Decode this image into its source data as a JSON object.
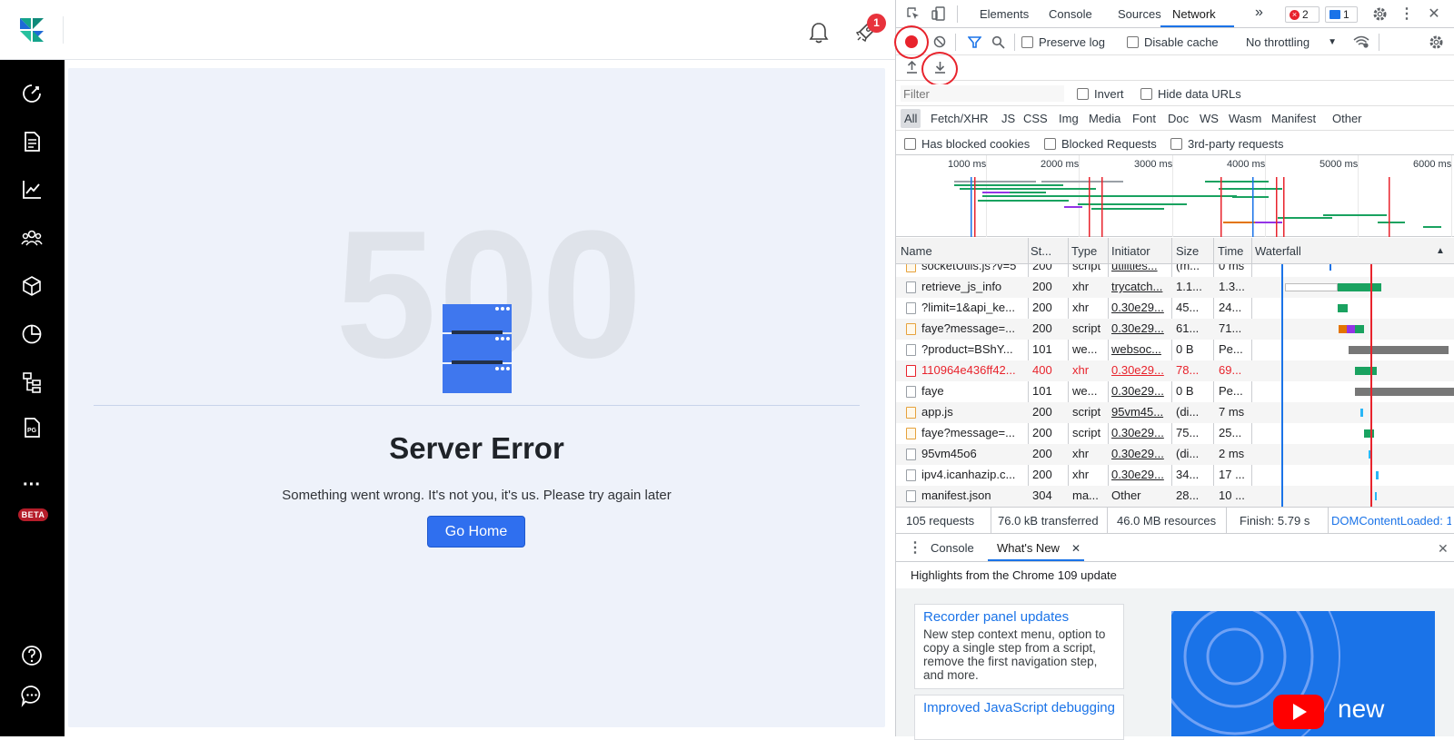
{
  "app": {
    "notification_count": "1",
    "sidebar": [
      {
        "name": "dashboard-icon"
      },
      {
        "name": "document-icon"
      },
      {
        "name": "chart-icon"
      },
      {
        "name": "users-icon"
      },
      {
        "name": "cube-icon"
      },
      {
        "name": "pie-chart-icon"
      },
      {
        "name": "hierarchy-icon"
      },
      {
        "name": "pdf-icon"
      },
      {
        "name": "more-icon"
      },
      {
        "name": "help-icon"
      },
      {
        "name": "chat-icon"
      }
    ],
    "beta_badge": "BETA",
    "more_label": "···",
    "error": {
      "code": "500",
      "title": "Server Error",
      "message": "Something went wrong. It's not you, it's us. Please try again later",
      "button": "Go Home"
    },
    "accent_color": "#2f6fef"
  },
  "devtools": {
    "tabs": [
      "Elements",
      "Console",
      "Sources",
      "Network"
    ],
    "active_tab": "Network",
    "more_tabs": "»",
    "error_count": "2",
    "message_count": "1",
    "toolbar": {
      "preserve_log": "Preserve log",
      "disable_cache": "Disable cache",
      "throttling": "No throttling"
    },
    "filter": {
      "placeholder": "Filter",
      "invert": "Invert",
      "hide_data_urls": "Hide data URLs"
    },
    "types": [
      "All",
      "Fetch/XHR",
      "JS",
      "CSS",
      "Img",
      "Media",
      "Font",
      "Doc",
      "WS",
      "Wasm",
      "Manifest",
      "Other"
    ],
    "blocked": {
      "has_blocked_cookies": "Has blocked cookies",
      "blocked_requests": "Blocked Requests",
      "third_party": "3rd-party requests"
    },
    "overview_ticks": [
      "1000 ms",
      "2000 ms",
      "3000 ms",
      "4000 ms",
      "5000 ms",
      "6000 ms"
    ],
    "columns": [
      "Name",
      "St...",
      "Type",
      "Initiator",
      "Size",
      "Time",
      "Waterfall"
    ],
    "rows": [
      {
        "name": "socketUtils.js?v=5",
        "status": "200",
        "type": "script",
        "initiator": "utilities...",
        "size": "(m...",
        "time": "0 ms",
        "icon": "script",
        "error": false
      },
      {
        "name": "retrieve_js_info",
        "status": "200",
        "type": "xhr",
        "initiator": "trycatch...",
        "size": "1.1...",
        "time": "1.3...",
        "icon": "doc",
        "error": false
      },
      {
        "name": "?limit=1&api_ke...",
        "status": "200",
        "type": "xhr",
        "initiator": "0.30e29...",
        "size": "45...",
        "time": "24...",
        "icon": "doc",
        "error": false
      },
      {
        "name": "faye?message=...",
        "status": "200",
        "type": "script",
        "initiator": "0.30e29...",
        "size": "61...",
        "time": "71...",
        "icon": "script",
        "error": false
      },
      {
        "name": "?product=BShY...",
        "status": "101",
        "type": "we...",
        "initiator": "websoc...",
        "size": "0 B",
        "time": "Pe...",
        "icon": "doc",
        "error": false
      },
      {
        "name": "110964e436ff42...",
        "status": "400",
        "type": "xhr",
        "initiator": "0.30e29...",
        "size": "78...",
        "time": "69...",
        "icon": "doc",
        "error": true
      },
      {
        "name": "faye",
        "status": "101",
        "type": "we...",
        "initiator": "0.30e29...",
        "size": "0 B",
        "time": "Pe...",
        "icon": "doc",
        "error": false
      },
      {
        "name": "app.js",
        "status": "200",
        "type": "script",
        "initiator": "95vm45...",
        "size": "(di...",
        "time": "7 ms",
        "icon": "script",
        "error": false
      },
      {
        "name": "faye?message=...",
        "status": "200",
        "type": "script",
        "initiator": "0.30e29...",
        "size": "75...",
        "time": "25...",
        "icon": "script",
        "error": false
      },
      {
        "name": "95vm45o6",
        "status": "200",
        "type": "xhr",
        "initiator": "0.30e29...",
        "size": "(di...",
        "time": "2 ms",
        "icon": "doc",
        "error": false
      },
      {
        "name": "ipv4.icanhazip.c...",
        "status": "200",
        "type": "xhr",
        "initiator": "0.30e29...",
        "size": "34...",
        "time": "17 ...",
        "icon": "doc",
        "error": false
      },
      {
        "name": "manifest.json",
        "status": "304",
        "type": "ma...",
        "initiator": "Other",
        "size": "28...",
        "time": "10 ...",
        "icon": "doc",
        "error": false
      }
    ],
    "status_bar": {
      "requests": "105 requests",
      "transferred": "76.0 kB transferred",
      "resources": "46.0 MB resources",
      "finish": "Finish: 5.79 s",
      "dcl": "DOMContentLoaded: 1"
    },
    "drawer": {
      "tabs": [
        "Console",
        "What's New"
      ],
      "highlights": "Highlights from the Chrome 109 update",
      "cards": [
        {
          "title": "Recorder panel updates",
          "body": "New step context menu, option to copy a single step from a script, remove the first navigation step, and more."
        },
        {
          "title": "Improved JavaScript debugging",
          "body": ""
        }
      ],
      "video_text": "new"
    }
  }
}
